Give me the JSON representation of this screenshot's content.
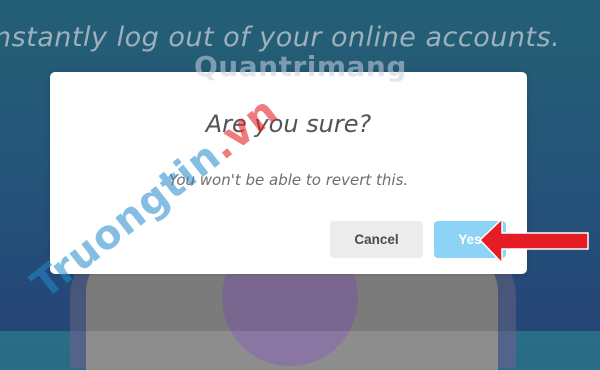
{
  "background": {
    "text": "nstantly log out of your online accounts."
  },
  "dialog": {
    "title": "Are you sure?",
    "message": "You won't be able to revert this.",
    "cancel_label": "Cancel",
    "confirm_label": "Yes"
  },
  "watermarks": {
    "left_main": "Truongtin",
    "left_suffix": ".vn",
    "right": "Quantrimang"
  },
  "colors": {
    "confirm": "#8dd3f6",
    "cancel": "#ececec",
    "arrow": "#e51c23"
  },
  "icons": {
    "arrow": "red-arrow-pointer"
  }
}
